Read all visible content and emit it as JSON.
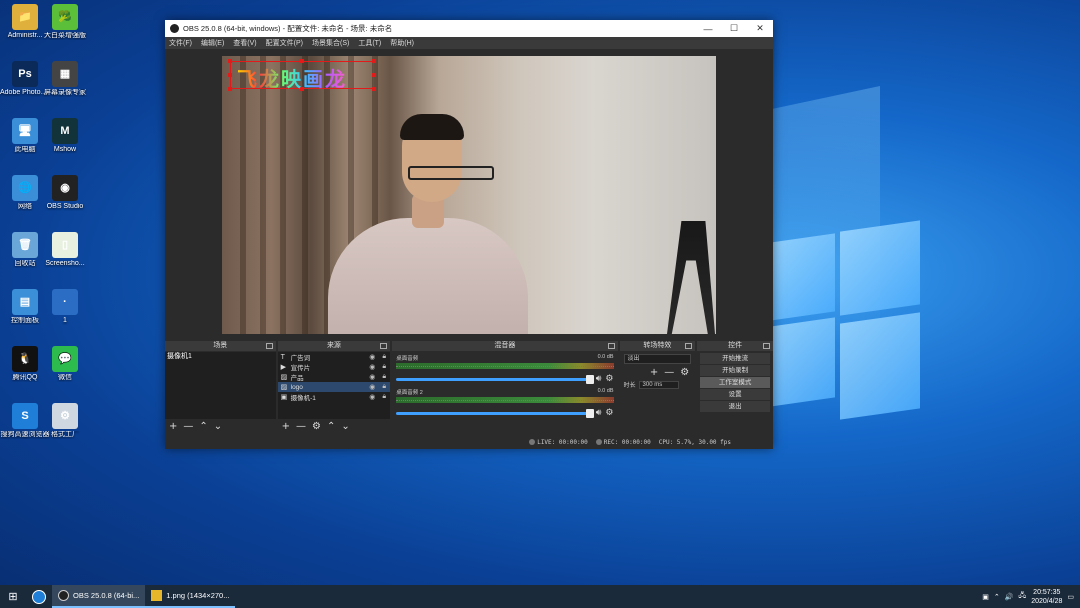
{
  "desktop": {
    "icons": [
      {
        "label": "Administr...",
        "icon": "user-folder-icon",
        "color": "#e0b03c",
        "glyph": "📁"
      },
      {
        "label": "大白菜增强版",
        "icon": "cabbage-icon",
        "color": "#5bbf3a",
        "glyph": "🥦"
      },
      {
        "label": "Adobe Photosho...",
        "icon": "photoshop-icon",
        "color": "#0b2a5a",
        "glyph": "Ps"
      },
      {
        "label": "屏幕录像专家",
        "icon": "screen-recorder-icon",
        "color": "#444444",
        "glyph": "▦"
      },
      {
        "label": "此电脑",
        "icon": "this-pc-icon",
        "color": "#3a8fd8",
        "glyph": "🖥"
      },
      {
        "label": "Mshow",
        "icon": "mshow-icon",
        "color": "#12333a",
        "glyph": "M"
      },
      {
        "label": "网络",
        "icon": "network-icon",
        "color": "#3a8fd8",
        "glyph": "🌐"
      },
      {
        "label": "OBS Studio",
        "icon": "obs-studio-icon",
        "color": "#222222",
        "glyph": "◉"
      },
      {
        "label": "回收站",
        "icon": "recycle-bin-icon",
        "color": "#6aa6d8",
        "glyph": "🗑"
      },
      {
        "label": "Screensho...",
        "icon": "screenshot-file-icon",
        "color": "#e8f0e0",
        "glyph": "▯"
      },
      {
        "label": "控制面板",
        "icon": "control-panel-icon",
        "color": "#3a8fd8",
        "glyph": "▤"
      },
      {
        "label": "1",
        "icon": "file-1-icon",
        "color": "#2b6cc4",
        "glyph": "·"
      },
      {
        "label": "腾讯QQ",
        "icon": "qq-icon",
        "color": "#111111",
        "glyph": "🐧"
      },
      {
        "label": "微信",
        "icon": "wechat-icon",
        "color": "#2dbb4e",
        "glyph": "💬"
      },
      {
        "label": "搜狗高速浏览器",
        "icon": "sogou-browser-icon",
        "color": "#1f7fd8",
        "glyph": "S"
      },
      {
        "label": "格式工厂",
        "icon": "format-factory-icon",
        "color": "#cfd8e0",
        "glyph": "⚙"
      }
    ]
  },
  "obs": {
    "title": "OBS 25.0.8 (64-bit, windows) - 配置文件: 未命名 - 场景: 未命名",
    "menu": [
      "文件(F)",
      "编辑(E)",
      "查看(V)",
      "配置文件(P)",
      "场景集合(S)",
      "工具(T)",
      "帮助(H)"
    ],
    "logo_text": "飞龙映画龙",
    "scenes": {
      "title": "场景",
      "items": [
        "摄像机1"
      ]
    },
    "sources": {
      "title": "来源",
      "items": [
        {
          "name": "广告词",
          "icon": "text-icon",
          "glyph": "T",
          "selected": false
        },
        {
          "name": "宣传片",
          "icon": "media-icon",
          "glyph": "▶",
          "selected": false
        },
        {
          "name": "产品",
          "icon": "image-icon",
          "glyph": "▨",
          "selected": false
        },
        {
          "name": "logo",
          "icon": "image-icon",
          "glyph": "▨",
          "selected": true
        },
        {
          "name": "摄像机-1",
          "icon": "camera-icon",
          "glyph": "▣",
          "selected": false
        }
      ]
    },
    "mixer": {
      "title": "混音器",
      "tracks": [
        {
          "name": "桌面音频",
          "db": "0.0 dB"
        },
        {
          "name": "桌面音频 2",
          "db": "0.0 dB"
        }
      ]
    },
    "transitions": {
      "title": "转场特效",
      "selected": "淡出",
      "duration_label": "时长",
      "duration_value": "300 ms"
    },
    "controls": {
      "title": "控件",
      "buttons": [
        "开始推流",
        "开始录制",
        "工作室模式",
        "设置",
        "退出"
      ],
      "hover_index": 2
    },
    "status": {
      "live": "LIVE: 00:00:00",
      "rec": "REC: 00:00:00",
      "cpu": "CPU: 5.7%, 30.00 fps"
    }
  },
  "taskbar": {
    "apps": [
      {
        "label": "OBS 25.0.8 (64-bi...",
        "icon": "obs-taskbar-icon"
      },
      {
        "label": "1.png (1434×270...",
        "icon": "image-viewer-icon"
      }
    ],
    "time": "20:57:35",
    "date": "2020/4/28"
  }
}
